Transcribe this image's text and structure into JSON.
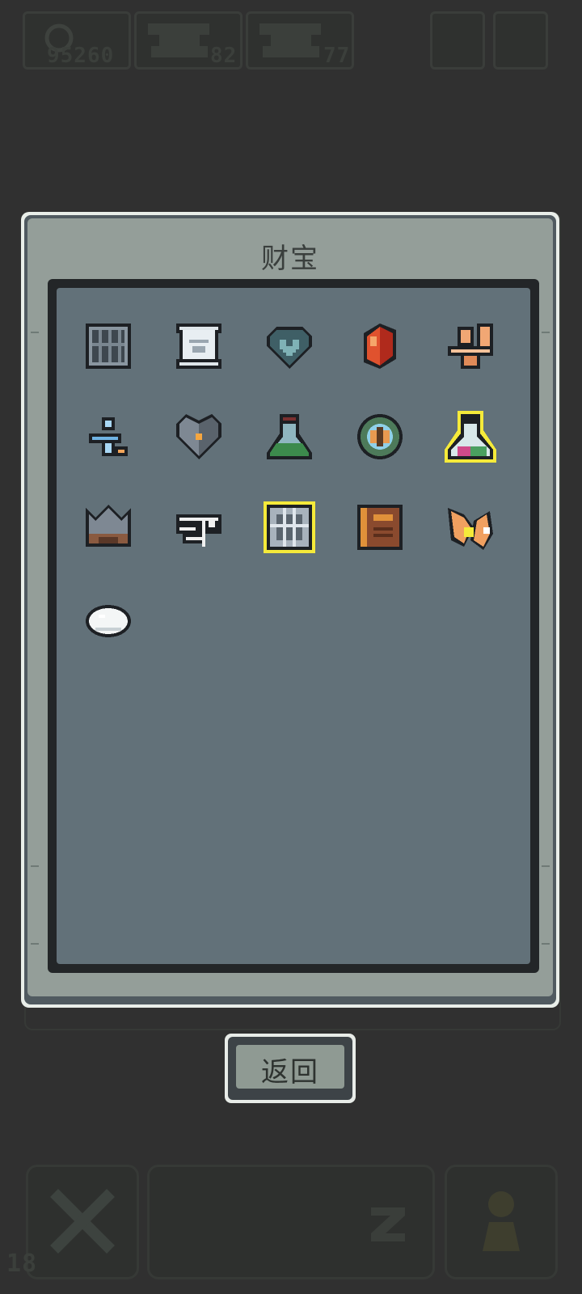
{
  "hud": {
    "coins": "95260",
    "res1": "82",
    "res2": "77"
  },
  "panel": {
    "title": "财宝"
  },
  "items": [
    {
      "name": "iron-cage-icon"
    },
    {
      "name": "scroll-icon"
    },
    {
      "name": "heart-gem-icon"
    },
    {
      "name": "red-crystal-icon"
    },
    {
      "name": "toilet-icon"
    },
    {
      "name": "blue-robot-icon"
    },
    {
      "name": "steel-heart-icon"
    },
    {
      "name": "green-potion-icon"
    },
    {
      "name": "butterfly-orb-icon"
    },
    {
      "name": "glowing-potion-icon"
    },
    {
      "name": "spiked-helmet-icon"
    },
    {
      "name": "eye-rune-icon"
    },
    {
      "name": "glowing-chip-icon"
    },
    {
      "name": "leather-book-icon"
    },
    {
      "name": "fox-tail-icon"
    },
    {
      "name": "rice-ball-icon"
    }
  ],
  "back_button": {
    "label": "返回"
  },
  "footer": {
    "level": "18"
  },
  "colors": {
    "background": "#303030",
    "panel_face": "#949e99",
    "grid_bg": "#627179"
  }
}
